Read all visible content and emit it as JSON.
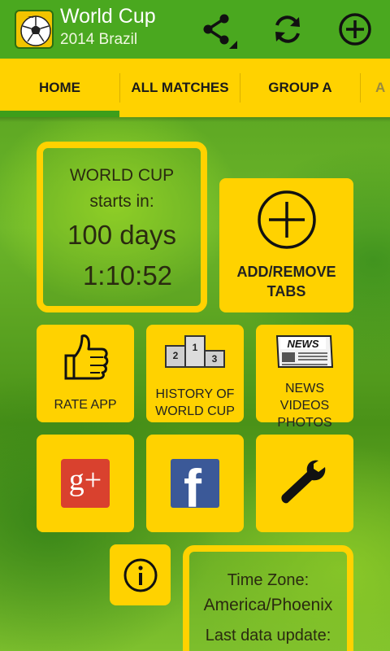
{
  "app": {
    "title": "World Cup",
    "subtitle": "2014 Brazil",
    "icons": [
      "share-icon",
      "refresh-icon",
      "add-circle-icon"
    ]
  },
  "tabs": [
    {
      "label": "HOME",
      "selected": true
    },
    {
      "label": "ALL MATCHES",
      "selected": false
    },
    {
      "label": "GROUP A",
      "selected": false
    },
    {
      "label": "A",
      "selected": false
    }
  ],
  "countdown": {
    "line1": "WORLD CUP",
    "line2": "starts in:",
    "days": "100 days",
    "time": "1:10:52"
  },
  "tiles": {
    "add_remove": "ADD/REMOVE TABS",
    "rate": "RATE APP",
    "history": "HISTORY OF WORLD CUP",
    "news": "NEWS VIDEOS PHOTOS",
    "news_badge": "NEWS",
    "podium": [
      "2",
      "1",
      "3"
    ],
    "gplus": "g+",
    "facebook": "f",
    "info": "i"
  },
  "timezone": {
    "label": "Time Zone:",
    "value": "America/Phoenix",
    "update_label": "Last data update:"
  },
  "colors": {
    "accent_yellow": "#ffd200",
    "actionbar_green": "#4aa81f",
    "gplus_red": "#d9412e",
    "facebook_blue": "#3b5998"
  }
}
